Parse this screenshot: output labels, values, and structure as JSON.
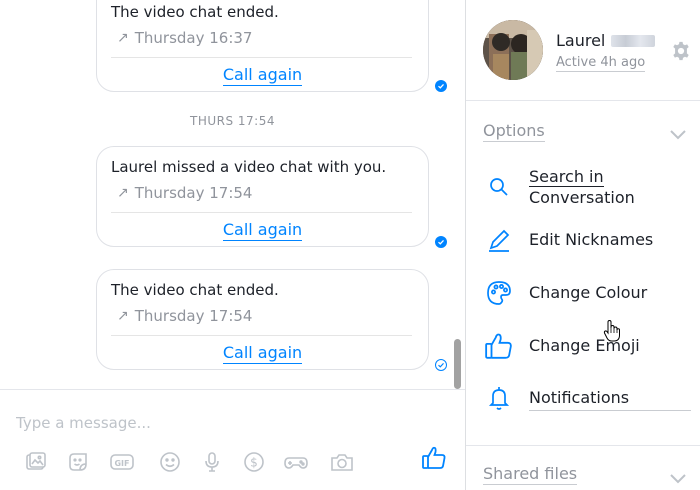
{
  "chat": {
    "messages": [
      {
        "title": "The video chat ended.",
        "time": "Thursday 16:37",
        "action": "Call again",
        "receipt": "seen"
      },
      {
        "title": "Laurel missed a video chat with you.",
        "time": "Thursday 17:54",
        "action": "Call again",
        "receipt": "seen"
      },
      {
        "title": "The video chat ended.",
        "time": "Thursday 17:54",
        "action": "Call again",
        "receipt": "delivered"
      }
    ],
    "time_divider": "THURS 17:54"
  },
  "composer": {
    "placeholder": "Type a message...",
    "gif_label": "GIF",
    "currency_symbol": "$",
    "tools": [
      "photo-icon",
      "sticker-icon",
      "gif-icon",
      "emoji-icon",
      "microphone-icon",
      "payment-icon",
      "game-controller-icon",
      "camera-icon",
      "thumbs-up-icon"
    ]
  },
  "panel": {
    "profile": {
      "name": "Laurel",
      "status": "Active 4h ago"
    },
    "options_header": "Options",
    "options": [
      {
        "icon": "search-icon",
        "label_line1": "Search in",
        "label_line2": "Conversation"
      },
      {
        "icon": "pencil-icon",
        "label": "Edit Nicknames"
      },
      {
        "icon": "palette-icon",
        "label": "Change Colour"
      },
      {
        "icon": "thumbs-up-icon",
        "label": "Change Emoji"
      },
      {
        "icon": "bell-icon",
        "label": "Notifications"
      }
    ],
    "shared_files_header": "Shared files"
  },
  "colors": {
    "accent": "#0084ff",
    "muted_text": "#90949c",
    "border": "#dfe1e6",
    "text": "#1d2129"
  }
}
